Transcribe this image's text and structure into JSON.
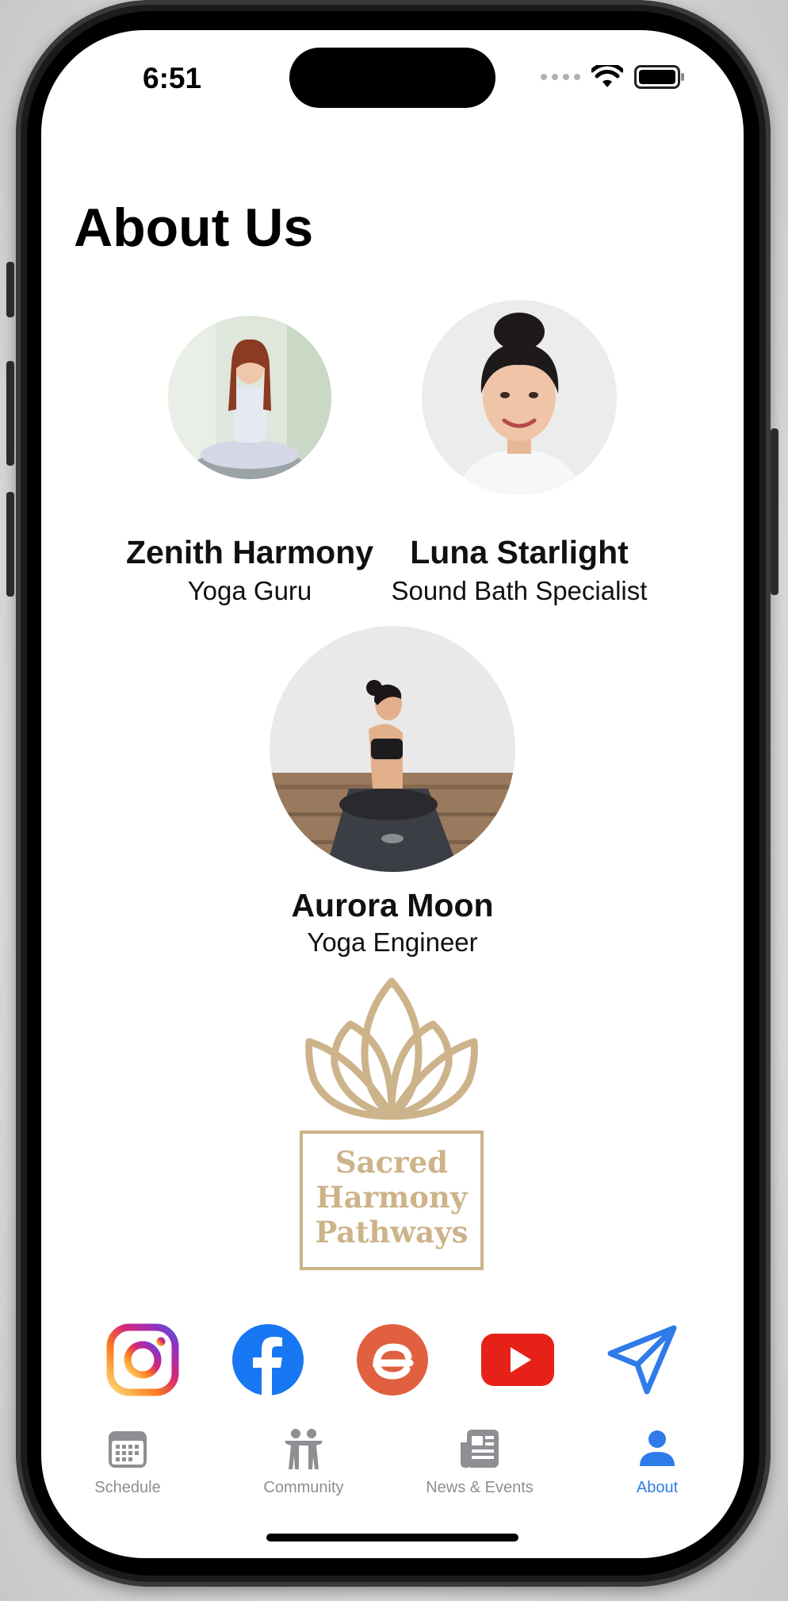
{
  "status_bar": {
    "time": "6:51"
  },
  "page": {
    "title": "About Us"
  },
  "team": [
    {
      "name": "Zenith Harmony",
      "role": "Yoga Guru"
    },
    {
      "name": "Luna Starlight",
      "role": "Sound Bath Specialist"
    },
    {
      "name": "Aurora Moon",
      "role": "Yoga Engineer"
    }
  ],
  "logo": {
    "lines": [
      "Sacred",
      "Harmony",
      "Pathways"
    ],
    "color": "#CDB38A"
  },
  "social_links": [
    {
      "icon": "instagram-icon"
    },
    {
      "icon": "facebook-icon",
      "color": "#1877F2"
    },
    {
      "icon": "eventbrite-icon",
      "color": "#E0603F"
    },
    {
      "icon": "youtube-icon",
      "color": "#E62117"
    },
    {
      "icon": "send-icon",
      "color": "#2F7BEA"
    }
  ],
  "tabs": [
    {
      "label": "Schedule",
      "icon": "calendar-icon",
      "active": false
    },
    {
      "label": "Community",
      "icon": "community-icon",
      "active": false
    },
    {
      "label": "News & Events",
      "icon": "newspaper-icon",
      "active": false
    },
    {
      "label": "About",
      "icon": "person-icon",
      "active": true
    }
  ],
  "colors": {
    "tab_active": "#2F7BEA",
    "tab_inactive": "#8E8E93"
  }
}
